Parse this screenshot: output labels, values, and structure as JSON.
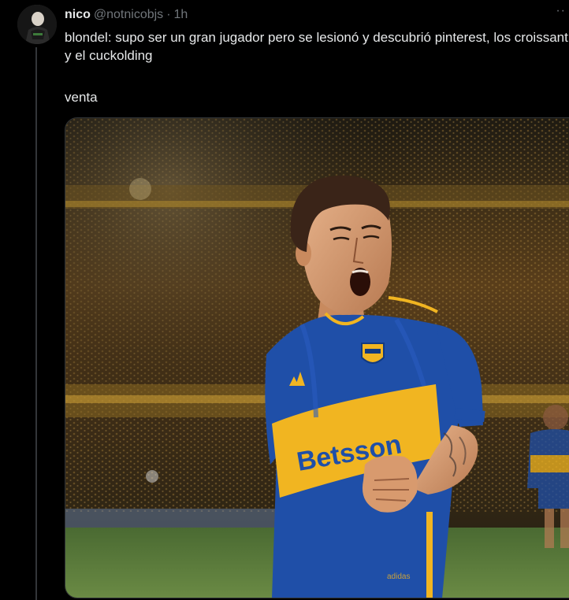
{
  "tweet": {
    "display_name": "nico",
    "handle": "@notnicobjs",
    "separator": "·",
    "time": "1h",
    "more_icon": "ellipsis-icon",
    "text_line1": "blondel: supo ser un gran jugador pero se lesionó y descubrió pinterest, los croissant y el cuckolding",
    "text_line2": "venta",
    "image": {
      "jersey_sponsor": "Betsson",
      "jersey_brand": "adidas",
      "crest": "CABJ",
      "colors": {
        "jersey_blue": "#1f4fa8",
        "jersey_yellow": "#f1b521",
        "crowd": "#3a2a14"
      }
    }
  }
}
